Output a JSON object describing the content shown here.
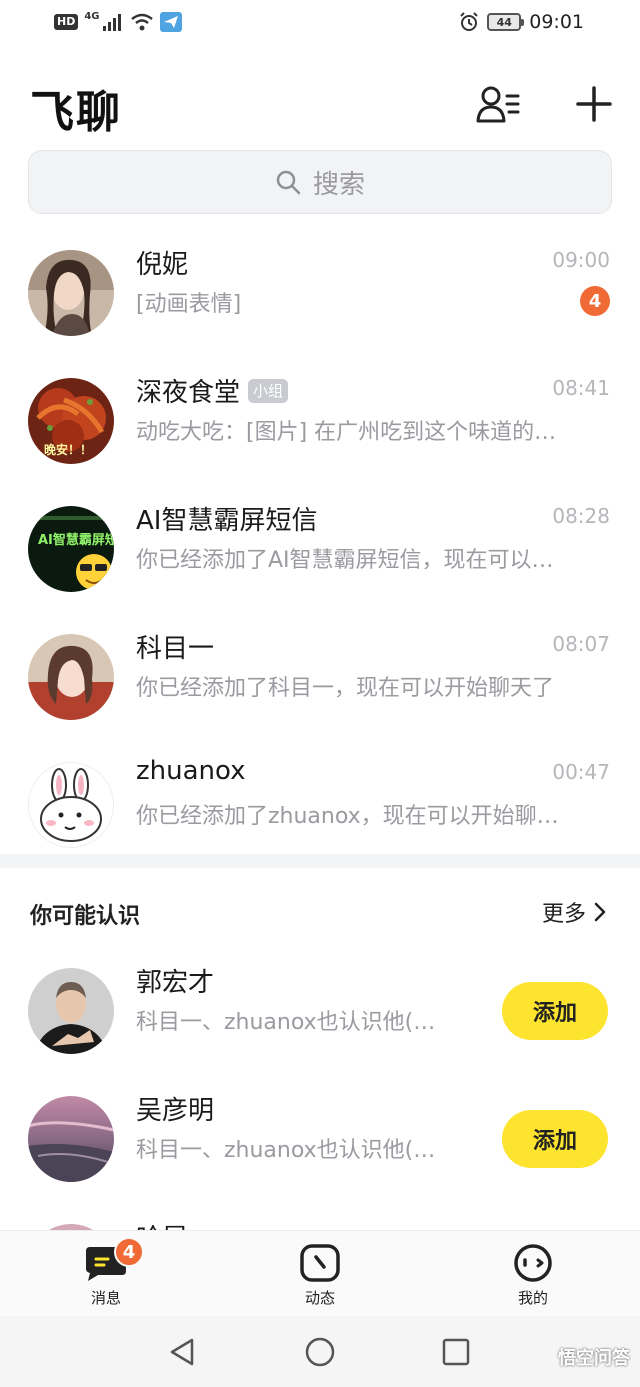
{
  "status_bar": {
    "hd": "HD",
    "network": "4G",
    "battery": "44",
    "time": "09:01"
  },
  "header": {
    "title": "飞聊"
  },
  "search": {
    "placeholder": "搜索"
  },
  "chats": [
    {
      "name": "倪妮",
      "tag": "",
      "time": "09:00",
      "preview": "[动画表情]",
      "unread": "4"
    },
    {
      "name": "深夜食堂",
      "tag": "小组",
      "time": "08:41",
      "preview": "动吃大吃：[图片] 在广州吃到这个味道的…",
      "unread": ""
    },
    {
      "name": "AI智慧霸屏短信",
      "tag": "",
      "time": "08:28",
      "preview": "你已经添加了AI智慧霸屏短信，现在可以…",
      "unread": ""
    },
    {
      "name": "科目一",
      "tag": "",
      "time": "08:07",
      "preview": "你已经添加了科目一，现在可以开始聊天了",
      "unread": ""
    },
    {
      "name": "zhuanox",
      "tag": "",
      "time": "00:47",
      "preview": "你已经添加了zhuanox，现在可以开始聊…",
      "unread": ""
    }
  ],
  "avatar_texts": {
    "food": "晚安！！",
    "ai_sign": "AI智慧霸屏短信"
  },
  "recommend": {
    "title": "你可能认识",
    "more": "更多",
    "add_label": "添加",
    "people": [
      {
        "name": "郭宏才",
        "mutual": "科目一、zhuanox也认识他(…"
      },
      {
        "name": "吴彦明",
        "mutual": "科目一、zhuanox也认识他(…"
      },
      {
        "name": "哈昆",
        "mutual": ""
      }
    ]
  },
  "tabs": [
    {
      "label": "消息",
      "badge": "4"
    },
    {
      "label": "动态",
      "badge": ""
    },
    {
      "label": "我的",
      "badge": ""
    }
  ],
  "watermark": "悟空问答",
  "colors": {
    "accent_yellow": "#fde42f",
    "badge_orange": "#f06a35",
    "search_bg": "#f2f3f5"
  }
}
